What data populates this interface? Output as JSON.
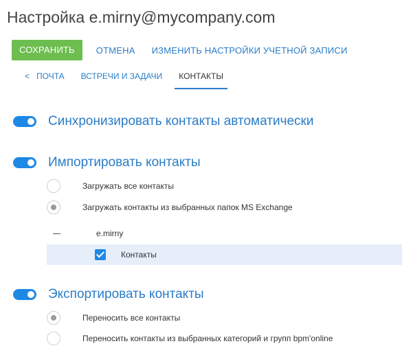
{
  "header": {
    "title": "Настройка e.mirny@mycompany.com"
  },
  "toolbar": {
    "save_label": "СОХРАНИТЬ",
    "cancel_label": "ОТМЕНА",
    "account_settings_label": "ИЗМЕНИТЬ НАСТРОЙКИ УЧЕТНОЙ ЗАПИСИ"
  },
  "tabs": [
    {
      "label": "ПОЧТА",
      "icon": "chevron-left-icon"
    },
    {
      "label": "ВСТРЕЧИ И ЗАДАЧИ"
    },
    {
      "label": "КОНТАКТЫ",
      "active": true
    }
  ],
  "sync": {
    "label": "Синхронизировать контакты автоматически",
    "enabled": true
  },
  "import": {
    "label": "Импортировать контакты",
    "enabled": true,
    "options": [
      {
        "label": "Загружать все контакты",
        "selected": false
      },
      {
        "label": "Загружать контакты из выбранных папок MS Exchange",
        "selected": true
      }
    ],
    "tree": {
      "root_label": "e.mirny",
      "children": [
        {
          "label": "Контакты",
          "checked": true
        }
      ]
    }
  },
  "export": {
    "label": "Экспортировать контакты",
    "enabled": true,
    "options": [
      {
        "label": "Переносить все контакты",
        "selected": true
      },
      {
        "label": "Переносить контакты из выбранных категорий и групп bpm'online",
        "selected": false
      }
    ]
  },
  "colors": {
    "accent": "#2a7cc7",
    "save_button": "#6dbd4f",
    "toggle": "#1e88e5",
    "selected_row": "#e6eefa"
  }
}
